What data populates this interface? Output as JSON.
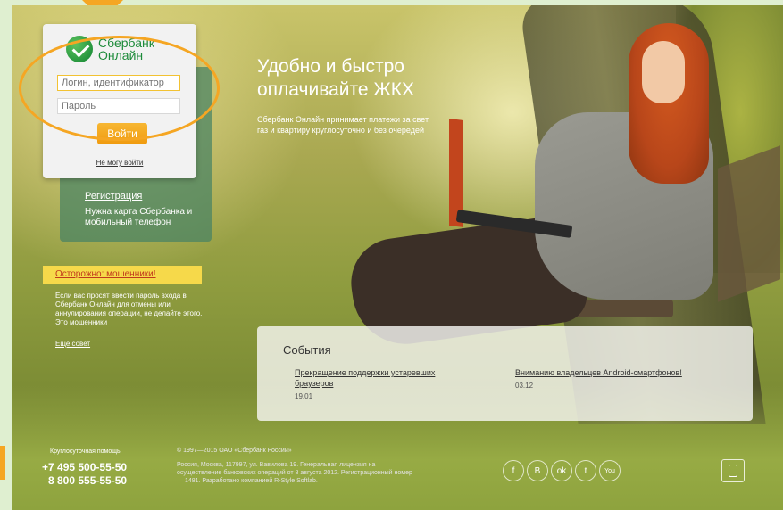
{
  "brand": {
    "name_line1": "Сбербанк",
    "name_line2": "Онлайн"
  },
  "login": {
    "login_placeholder": "Логин, идентификатор",
    "password_placeholder": "Пароль",
    "submit_label": "Войти",
    "cant_login_label": "Не могу войти"
  },
  "registration": {
    "link_label": "Регистрация",
    "note": "Нужна карта Сбербанка и мобильный телефон"
  },
  "fraud": {
    "title": "Осторожно: мошенники!",
    "text": "Если вас просят ввести пароль входа в Сбербанк Онлайн для отмены или аннулирования операции, не делайте этого. Это мошенники",
    "more_label": "Еще совет"
  },
  "promo": {
    "headline": "Удобно и быстро оплачивайте ЖКХ",
    "subline": "Сбербанк Онлайн принимает платежи за свет, газ и квартиру круглосуточно и без очередей"
  },
  "events": {
    "title": "События",
    "items": [
      {
        "title": "Прекращение поддержки устаревших браузеров",
        "date": "19.01"
      },
      {
        "title": "Вниманию владельцев Android-смартфонов!",
        "date": "03.12"
      }
    ]
  },
  "footer": {
    "support_label": "Круглосуточная помощь",
    "phone1": "+7 495 500-55-50",
    "phone2": "8 800 555-55-50",
    "copyright": "© 1997—2015 ОАО «Сбербанк России»",
    "address": "Россия, Москва, 117997, ул. Вавилова 19. Генеральная лицензия на осуществление банковских операций от 8 августа 2012. Регистрационный номер — 1481. Разработано компанией R-Style Softlab.",
    "socials": [
      {
        "icon": "facebook-icon",
        "glyph": "f"
      },
      {
        "icon": "vkontakte-icon",
        "glyph": "B"
      },
      {
        "icon": "odnoklassniki-icon",
        "glyph": "ok"
      },
      {
        "icon": "twitter-icon",
        "glyph": "t"
      },
      {
        "icon": "youtube-icon",
        "glyph": "You"
      }
    ]
  },
  "colors": {
    "accent": "#f5a623",
    "brand_green": "#1d8b3a",
    "fraud_bg": "#f6d94a"
  }
}
